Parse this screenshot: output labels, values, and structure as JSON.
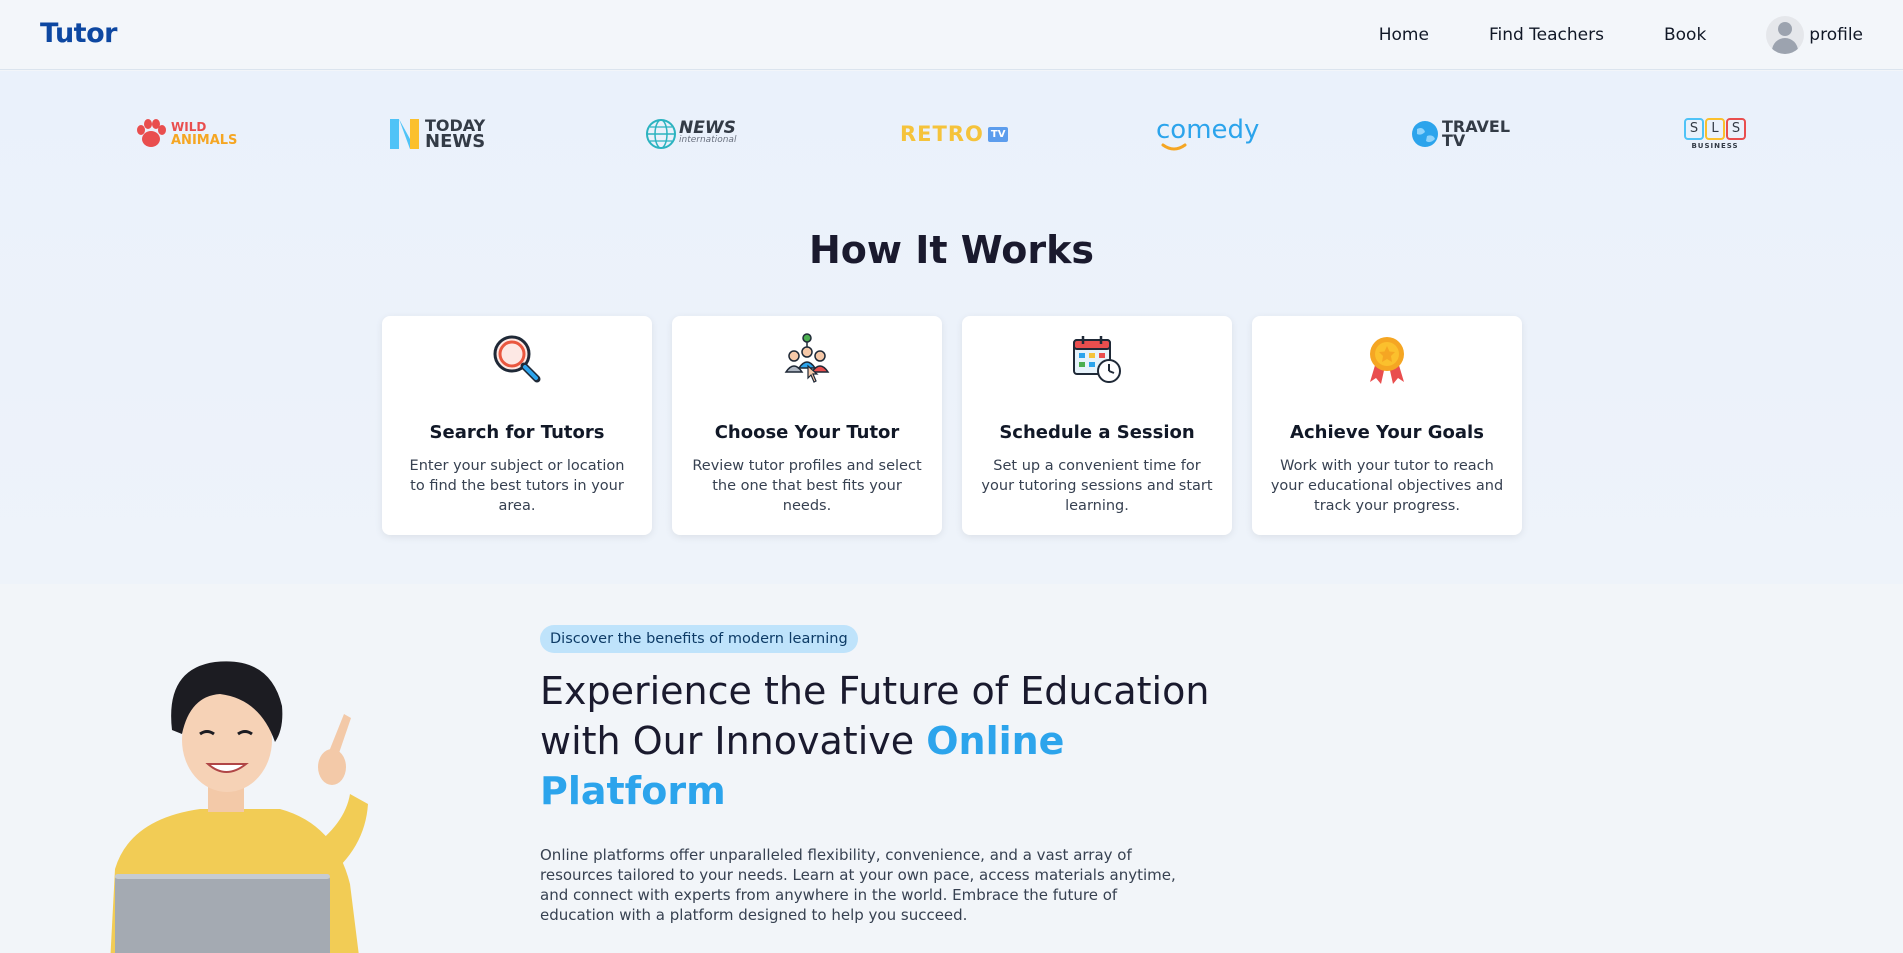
{
  "nav": {
    "logo": "Tutor",
    "links": [
      "Home",
      "Find Teachers",
      "Book"
    ],
    "profile_label": "profile"
  },
  "brands": [
    {
      "name": "wild-animals",
      "line1": "WILD",
      "line2": "ANIMALS",
      "color": "#e94e4e"
    },
    {
      "name": "today-news",
      "line1": "TODAY",
      "line2": "NEWS",
      "color": "#333b46"
    },
    {
      "name": "news-international",
      "line1": "NEWS",
      "line2": "international",
      "color": "#2bb3c0"
    },
    {
      "name": "retro-tv",
      "line1": "RETRO",
      "line2": "TV",
      "color": "#f5c33b"
    },
    {
      "name": "comedy",
      "line1": "comedy",
      "line2": "",
      "color": "#2ca4ec"
    },
    {
      "name": "travel-tv",
      "line1": "TRAVEL",
      "line2": "TV",
      "color": "#333b46"
    },
    {
      "name": "sls-business",
      "line1": "SLS",
      "line2": "BUSINESS",
      "color": "#333b46"
    }
  ],
  "how": {
    "title": "How It Works",
    "cards": [
      {
        "icon": "magnifier-icon",
        "title": "Search for Tutors",
        "desc": "Enter your subject or location to find the best tutors in your area."
      },
      {
        "icon": "people-select-icon",
        "title": "Choose Your Tutor",
        "desc": "Review tutor profiles and select the one that best fits your needs."
      },
      {
        "icon": "calendar-clock-icon",
        "title": "Schedule a Session",
        "desc": "Set up a convenient time for your tutoring sessions and start learning."
      },
      {
        "icon": "medal-icon",
        "title": "Achieve Your Goals",
        "desc": "Work with your tutor to reach your educational objectives and track your progress."
      }
    ]
  },
  "hero": {
    "badge": "Discover the benefits of modern learning",
    "title_plain": "Experience the Future of Education with Our Innovative",
    "title_accent": "Online Platform",
    "text": "Online platforms offer unparalleled flexibility, convenience, and a vast array of resources tailored to your needs. Learn at your own pace, access materials anytime, and connect with experts from anywhere in the world. Embrace the future of education with a platform designed to help you succeed."
  },
  "colors": {
    "brand_blue": "#0d47a1",
    "accent": "#2ca4ec",
    "badge_bg": "#bfe3fb"
  }
}
